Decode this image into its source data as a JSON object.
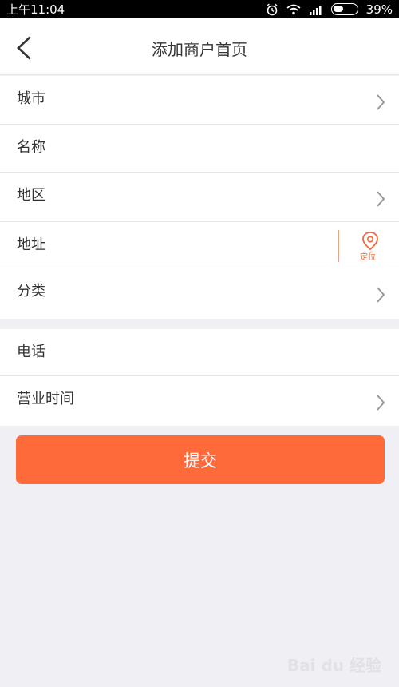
{
  "status": {
    "time": "上午11:04",
    "battery": "39%"
  },
  "header": {
    "title": "添加商户首页"
  },
  "form": {
    "group1": [
      {
        "label": "城市",
        "chevron": true
      },
      {
        "label": "名称",
        "chevron": false
      },
      {
        "label": "地区",
        "chevron": true
      },
      {
        "label": "地址",
        "chevron": false
      },
      {
        "label": "分类",
        "chevron": true
      }
    ],
    "group2": [
      {
        "label": "电话",
        "chevron": false
      },
      {
        "label": "营业时间",
        "chevron": true
      }
    ],
    "locate_label": "定位"
  },
  "submit_label": "提交",
  "watermark": "Bai du 经验",
  "colors": {
    "accent": "#fe6a3a",
    "background": "#f0eff4"
  }
}
